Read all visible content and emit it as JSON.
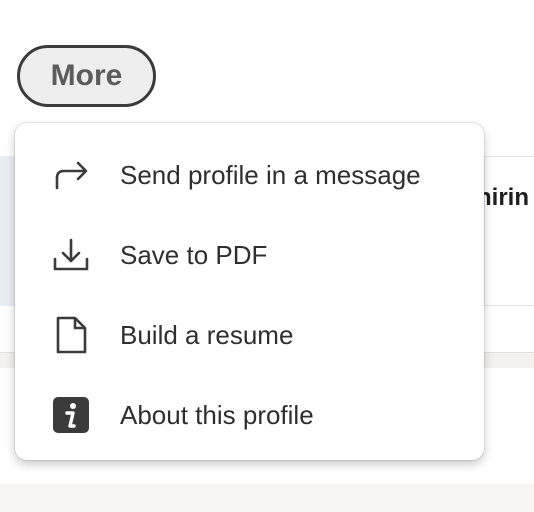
{
  "more_button": {
    "label": "More"
  },
  "background": {
    "partial_text": "hirin"
  },
  "dropdown": {
    "items": [
      {
        "label": "Send profile in a message",
        "icon": "share-arrow-icon"
      },
      {
        "label": "Save to PDF",
        "icon": "download-icon"
      },
      {
        "label": "Build a resume",
        "icon": "document-icon"
      },
      {
        "label": "About this profile",
        "icon": "info-icon"
      }
    ]
  },
  "colors": {
    "icon": "#3b3b3b",
    "text": "#2f2f2f",
    "button_bg": "#eeeeee",
    "button_border": "#3b3b3b"
  }
}
